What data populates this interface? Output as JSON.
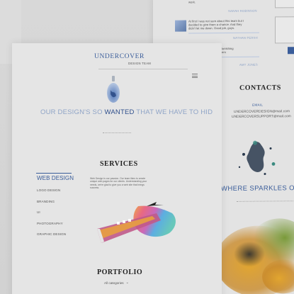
{
  "testimonials": [
    {
      "text_lines": [
        "work."
      ],
      "author": "SARAH ROBINSON"
    },
    {
      "text_lines": [
        "At first I was not sure about this team but I",
        "decided to give them a chance. And they",
        "didn't let me down. Good job, guys."
      ],
      "author": "NATHAN PERSH"
    },
    {
      "text_lines": [
        "It was so awesome as astonishing",
        "that I was pleased with them"
      ],
      "author": "AMY JONES"
    }
  ],
  "contacts": {
    "title": "CONTACTS",
    "email_label": "EMAIL",
    "emails": [
      "UNDERCOVERDESIGN@mail.com",
      "UNDERCOVERSUPPORT@mail.com"
    ],
    "tagline": "WHERE SPARKLES OF IDE"
  },
  "site": {
    "logo": "UNDERCOVER",
    "logo_sub": "DESIGN TEAM",
    "hero_tagline_a": "OUR DESIGN'S SO ",
    "hero_tagline_b": "WANTED",
    "hero_tagline_c": " THAT WE HAVE TO HID"
  },
  "services": {
    "title": "SERVICES",
    "items": [
      "WEB DESIGN",
      "LOGO DESIGN",
      "BRANDING",
      "UI",
      "PHOTOGRAPHY",
      "GRAPHIC DESIGN"
    ],
    "active": "WEB DESIGN",
    "description_lines": [
      "Web Design is our passion. Our team likes to create",
      "unique web pages for our clients. Understanding your",
      "needs, we're glad to give you a web site that brings",
      "success."
    ]
  },
  "portfolio": {
    "title": "PORTFOLIO",
    "filter_value": "All categories"
  },
  "colors": {
    "accent_blue": "#3a5d9a",
    "link_blue": "#8aa0c6",
    "text_gray": "#555555",
    "page_bg": "#e5e5e5"
  },
  "icons": [
    "hamburger-menu-icon",
    "chevron-down-icon",
    "avatar-image",
    "watercolor-splash-image"
  ]
}
